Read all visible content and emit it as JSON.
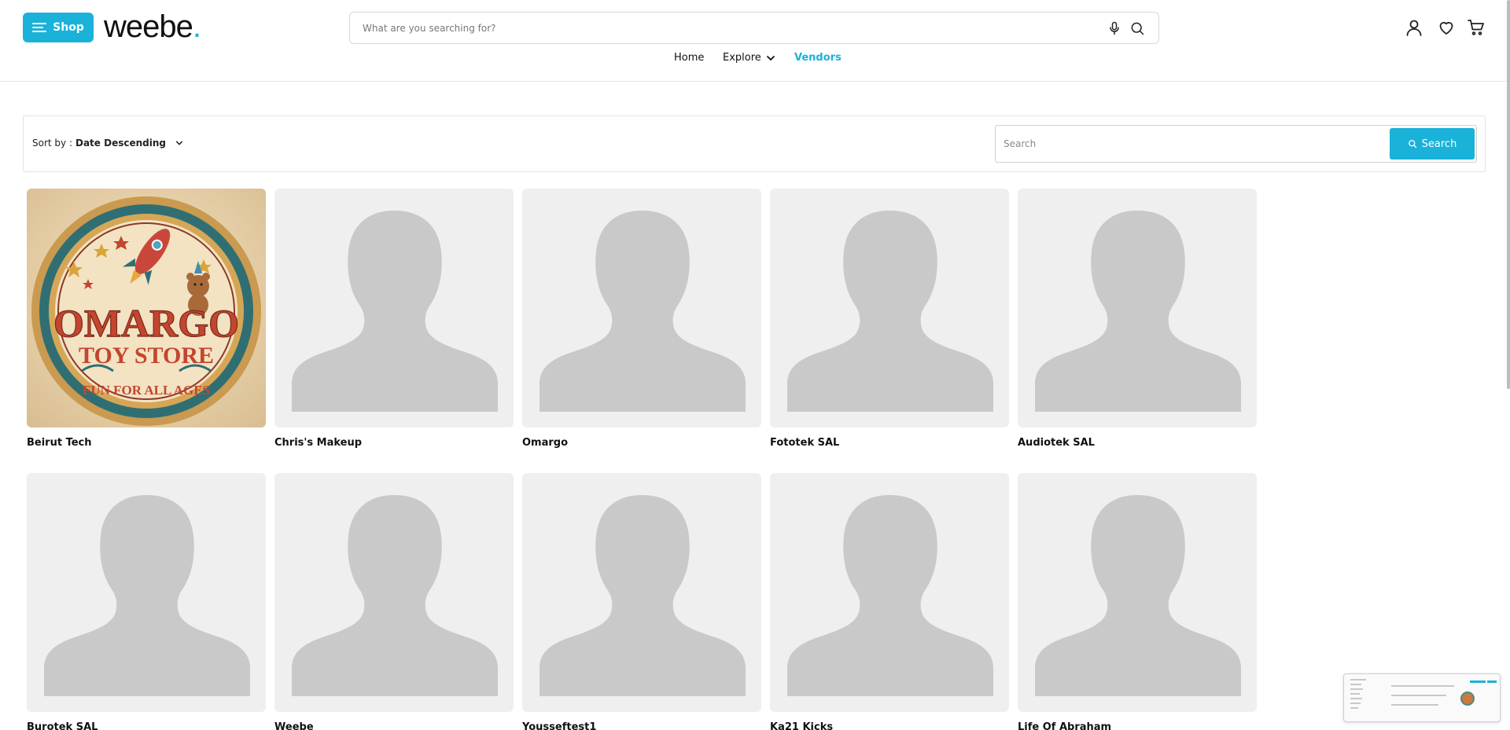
{
  "header": {
    "shop_label": "Shop",
    "logo_text": "weebe",
    "logo_dot": ".",
    "search_placeholder": "What are you searching for?",
    "nav": {
      "home": "Home",
      "explore": "Explore",
      "vendors": "Vendors"
    },
    "icons": [
      "user-icon",
      "heart-icon",
      "cart-icon",
      "mic-icon",
      "search-icon"
    ]
  },
  "filter": {
    "sort_label": "Sort by : ",
    "sort_value": "Date Descending",
    "search_placeholder": "Search",
    "search_button": "Search"
  },
  "vendors": [
    {
      "name": "Beirut Tech",
      "image": "omargo-badge"
    },
    {
      "name": "Chris's Makeup",
      "image": "placeholder-avatar"
    },
    {
      "name": "Omargo",
      "image": "placeholder-avatar"
    },
    {
      "name": "Fototek SAL",
      "image": "placeholder-avatar"
    },
    {
      "name": "Audiotek SAL",
      "image": "placeholder-avatar"
    },
    {
      "name": "Burotek SAL",
      "image": "placeholder-avatar"
    },
    {
      "name": "Weebe",
      "image": "placeholder-avatar"
    },
    {
      "name": "Yousseftest1",
      "image": "placeholder-avatar"
    },
    {
      "name": "Ka21 Kicks",
      "image": "placeholder-avatar"
    },
    {
      "name": "Life Of Abraham",
      "image": "placeholder-avatar"
    }
  ],
  "badge": {
    "line1": "OMARGO",
    "line2": "TOY STORE",
    "line3": "FUN FOR ALL AGES"
  },
  "colors": {
    "accent": "#1ab2d9",
    "placeholder_bg": "#efefef",
    "placeholder_figure": "#c9c9c9"
  }
}
